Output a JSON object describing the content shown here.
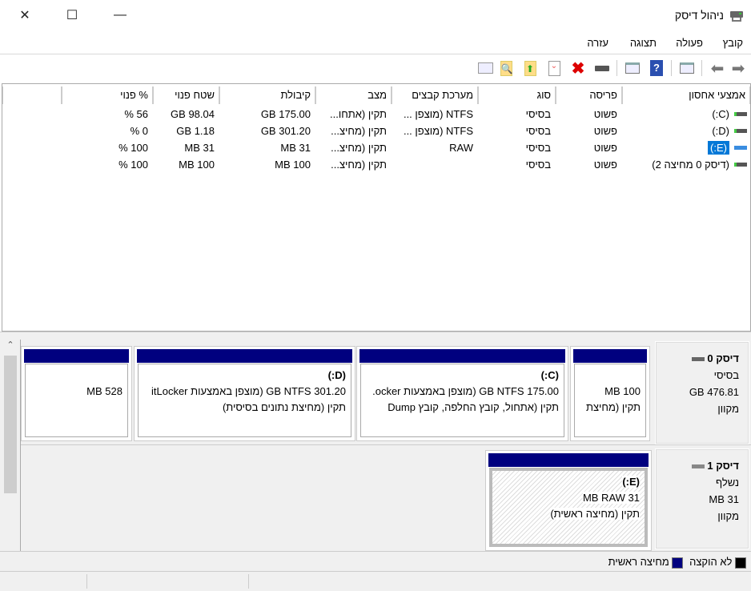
{
  "window": {
    "title": "ניהול דיסק",
    "minimize": "—",
    "maximize": "☐",
    "close": "✕"
  },
  "menu": [
    "קובץ",
    "פעולה",
    "תצוגה",
    "עזרה"
  ],
  "columns": [
    "אמצעי אחסון",
    "פריסה",
    "סוג",
    "מערכת קבצים",
    "מצב",
    "קיבולת",
    "שטח פנוי",
    "% פנוי"
  ],
  "volumes": [
    {
      "name": "(C:)",
      "layout": "פשוט",
      "type": "בסיסי",
      "fs": "NTFS (מוצפן ...",
      "status": "תקין (אתחו...",
      "capacity": "175.00 GB",
      "free": "98.04 GB",
      "pct": "56 %",
      "selected": false
    },
    {
      "name": "(D:)",
      "layout": "פשוט",
      "type": "בסיסי",
      "fs": "NTFS (מוצפן ...",
      "status": "תקין (מחיצ...",
      "capacity": "301.20 GB",
      "free": "1.18 GB",
      "pct": "0 %",
      "selected": false
    },
    {
      "name": "(E:)",
      "layout": "פשוט",
      "type": "בסיסי",
      "fs": "RAW",
      "status": "תקין (מחיצ...",
      "capacity": "31 MB",
      "free": "31 MB",
      "pct": "100 %",
      "selected": true
    },
    {
      "name": "(דיסק 0 מחיצה 2)",
      "layout": "פשוט",
      "type": "בסיסי",
      "fs": "",
      "status": "תקין (מחיצ...",
      "capacity": "100 MB",
      "free": "100 MB",
      "pct": "100 %",
      "selected": false
    }
  ],
  "disk0": {
    "name": "דיסק 0",
    "type": "בסיסי",
    "size": "476.81 GB",
    "state": "מקוון",
    "parts": [
      {
        "title": "",
        "line1": "100 MB",
        "line2": "תקין (מחיצת"
      },
      {
        "title": "(C:)",
        "line1": "175.00 GB NTFS (מוצפן באמצעות ocker.",
        "line2": "תקין (אתחול, קובץ החלפה, קובץ Dump"
      },
      {
        "title": "(D:)",
        "line1": "301.20 GB NTFS (מוצפן באמצעות itLocker",
        "line2": "תקין (מחיצת נתונים בסיסית)"
      },
      {
        "title": "",
        "line1": "528 MB",
        "line2": ""
      }
    ]
  },
  "disk1": {
    "name": "דיסק 1",
    "type": "נשלף",
    "size": "31 MB",
    "state": "מקוון",
    "part": {
      "title": "(E:)",
      "line1": "31 MB RAW",
      "line2": "תקין (מחיצה ראשית)"
    }
  },
  "legend": {
    "unallocated": "לא הוקצה",
    "primary": "מחיצה ראשית"
  },
  "colors": {
    "partition_bar": "#00007f",
    "selection": "#0078d7"
  }
}
